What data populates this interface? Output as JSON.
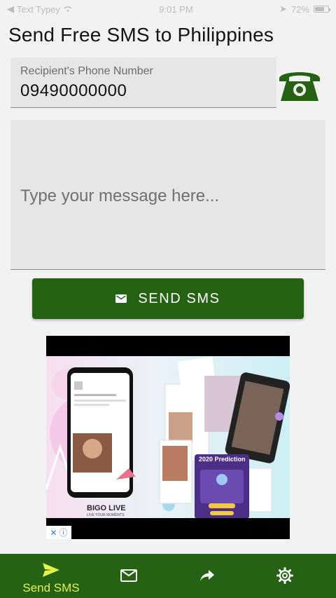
{
  "status_bar": {
    "carrier": "Text Typey",
    "time": "9:01 PM",
    "battery": "72%",
    "battery_level": 0.72
  },
  "page": {
    "title": "Send Free SMS to Philippines"
  },
  "recipient": {
    "label": "Recipient's Phone Number",
    "value": "09490000000"
  },
  "message": {
    "placeholder": "Type your message here..."
  },
  "send_button": {
    "label": "SEND SMS"
  },
  "ad": {
    "brand": "BIGO LIVE",
    "tagline": "LIVE YOUR MOMENTS",
    "prediction": "2020 Prediction"
  },
  "bottom_nav": {
    "items": [
      {
        "label": "Send SMS",
        "icon": "send-icon",
        "active": true
      },
      {
        "label": "",
        "icon": "mail-icon",
        "active": false
      },
      {
        "label": "",
        "icon": "share-icon",
        "active": false
      },
      {
        "label": "",
        "icon": "settings-icon",
        "active": false
      }
    ]
  },
  "colors": {
    "primary": "#266214",
    "active_nav": "#e4f34a",
    "field_bg": "#e6e6e6",
    "background": "#f2f2f2"
  }
}
